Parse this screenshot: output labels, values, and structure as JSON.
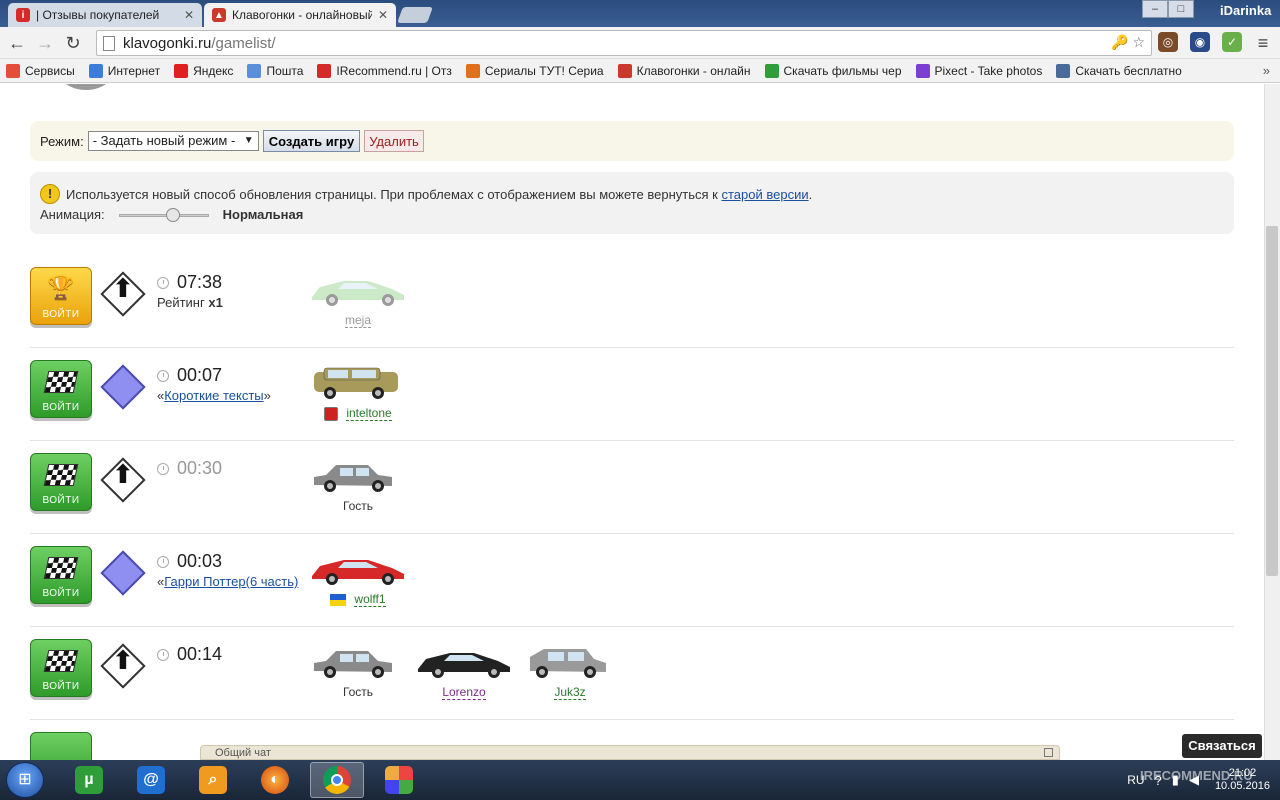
{
  "browser": {
    "tabs": [
      {
        "title": "| Отзывы покупателей",
        "active": false
      },
      {
        "title": "Клавогонки - онлайновый",
        "active": true
      }
    ],
    "window_brand": "iDarinka",
    "url_domain": "klavogonki.ru",
    "url_path": "/gamelist/",
    "bookmarks": [
      {
        "label": "Сервисы",
        "color": "#e44d3a"
      },
      {
        "label": "Интернет",
        "color": "#3b7dd8"
      },
      {
        "label": "Яндекс",
        "color": "#e02020"
      },
      {
        "label": "Пошта",
        "color": "#5a8fd8"
      },
      {
        "label": "IRecommend.ru | Отз",
        "color": "#d42a2a"
      },
      {
        "label": "Сериалы ТУТ! Сериа",
        "color": "#e0701e"
      },
      {
        "label": "Клавогонки - онлайн",
        "color": "#c93a2a"
      },
      {
        "label": "Скачать фильмы чер",
        "color": "#2f9e3a"
      },
      {
        "label": "Pixect - Take photos",
        "color": "#7a3fd0"
      },
      {
        "label": "Скачать бесплатно",
        "color": "#4a6b9a"
      }
    ]
  },
  "mode_panel": {
    "label": "Режим:",
    "select_value": "- Задать новый режим -",
    "create_label": "Создать игру",
    "delete_label": "Удалить"
  },
  "notice": {
    "text": "Используется новый способ обновления страницы. При проблемах с отображением вы можете вернуться к",
    "link": "старой версии",
    "suffix": ".",
    "animation_label": "Анимация:",
    "animation_value": "Нормальная",
    "animation_level": 0.62
  },
  "games": [
    {
      "button": "ВОЙТИ",
      "kind": "gold",
      "mode": "arrow",
      "time": "07:38",
      "time_dim": false,
      "sub_prefix": "Рейтинг ",
      "sub_bold": "x1",
      "sub_link": "",
      "sub_suffix": "",
      "players": [
        {
          "nick": "meja",
          "car": "#8fcf86",
          "type": "sport",
          "faded": true,
          "flag": ""
        }
      ]
    },
    {
      "button": "ВОЙТИ",
      "kind": "green",
      "mode": "violet",
      "time": "00:07",
      "time_dim": false,
      "sub_prefix": "«",
      "sub_bold": "",
      "sub_link": "Короткие тексты",
      "sub_suffix": "»",
      "players": [
        {
          "nick": "inteltone",
          "car": "#a89a5a",
          "type": "suv",
          "faded": false,
          "flag": "red"
        }
      ]
    },
    {
      "button": "ВОЙТИ",
      "kind": "green",
      "mode": "arrow",
      "time": "00:30",
      "time_dim": true,
      "sub_prefix": "",
      "sub_bold": "",
      "sub_link": "",
      "sub_suffix": "",
      "players": [
        {
          "nick": "Гость",
          "car": "#8a8a8a",
          "type": "sedan",
          "faded": false,
          "flag": ""
        }
      ]
    },
    {
      "button": "ВОЙТИ",
      "kind": "green",
      "mode": "violet",
      "time": "00:03",
      "time_dim": false,
      "sub_prefix": "«",
      "sub_bold": "",
      "sub_link": "Гарри Поттер(6 часть)",
      "sub_suffix": "",
      "players": [
        {
          "nick": "wolff1",
          "car": "#d62828",
          "type": "sport",
          "faded": false,
          "flag": "ua"
        }
      ]
    },
    {
      "button": "ВОЙТИ",
      "kind": "green",
      "mode": "arrow",
      "time": "00:14",
      "time_dim": false,
      "sub_prefix": "",
      "sub_bold": "",
      "sub_link": "",
      "sub_suffix": "",
      "players": [
        {
          "nick": "Гость",
          "car": "#8a8a8a",
          "type": "sedan",
          "faded": false,
          "flag": ""
        },
        {
          "nick": "Lorenzo",
          "car": "#222222",
          "type": "sport",
          "faded": false,
          "flag": ""
        },
        {
          "nick": "Juk3z",
          "car": "#9a9a9a",
          "type": "van",
          "faded": false,
          "flag": ""
        }
      ]
    }
  ],
  "chat": {
    "label": "Общий чат"
  },
  "contact_label": "Связаться",
  "taskbar": {
    "lang": "RU",
    "time": "21:02",
    "date": "10.05.2016",
    "watermark": "IRECOMMEND.RU"
  }
}
